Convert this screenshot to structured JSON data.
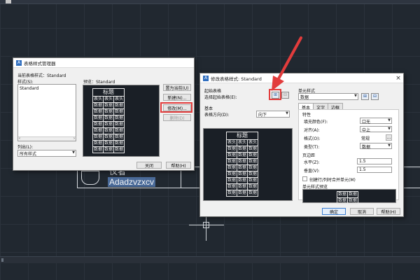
{
  "canvas": {
    "text_fragment": "仪者",
    "selected_text": "Adadzvzxcv"
  },
  "style_manager": {
    "title": "表格样式管理器",
    "current_style_label": "当前表格样式：Standard",
    "styles_label": "样式(S):",
    "style_items": [
      "Standard"
    ],
    "preview_label": "预览：Standard",
    "list_label": "列出(L):",
    "list_value": "所有样式",
    "buttons": {
      "set_current": "置为当前(U)",
      "new": "新建(N)...",
      "modify": "修改(M)...",
      "delete": "删除(D)",
      "close": "关闭",
      "help": "帮助(H)"
    },
    "preview_table": {
      "title": "标题",
      "header": [
        "表头",
        "表头",
        "表头"
      ],
      "rows": [
        [
          "数据",
          "数据",
          "数据"
        ],
        [
          "数据",
          "数据",
          "数据"
        ],
        [
          "数据",
          "数据",
          "数据"
        ],
        [
          "数据",
          "数据",
          "数据"
        ],
        [
          "数据",
          "数据",
          "数据"
        ],
        [
          "数据",
          "数据",
          "数据"
        ],
        [
          "数据",
          "数据",
          "数据"
        ],
        [
          "数据",
          "数据",
          "数据"
        ]
      ]
    }
  },
  "modify_dialog": {
    "title": "修改表格样式: Standard",
    "start_table_label": "起始表格",
    "choose_start_label": "选择起始表格(E):",
    "basic_label": "基本",
    "direction_label": "表格方向(D):",
    "direction_value": "向下",
    "cell_style_label": "单元样式",
    "cell_style_value": "数据",
    "tabs": [
      "基本",
      "文字",
      "边框"
    ],
    "properties_label": "特性",
    "fill_color_label": "填充颜色(F):",
    "fill_color_value": "口无",
    "align_label": "对齐(A):",
    "align_value": "中上",
    "format_label": "格式(O):",
    "format_value": "常规",
    "type_label": "类型(T):",
    "type_value": "数据",
    "margins_label": "页边距",
    "horizontal_label": "水平(Z):",
    "horizontal_value": "1.5",
    "vertical_label": "垂直(V):",
    "vertical_value": "1.5",
    "merge_label": "创建行/列时合并单元(M)",
    "cell_preview_label": "单元样式预览",
    "cell_preview": [
      "数据",
      "数据",
      "数据",
      "数据"
    ],
    "buttons": {
      "ok": "确定",
      "cancel": "取消",
      "help": "帮助(H)"
    },
    "preview_table": {
      "title": "标题",
      "header": [
        "表头",
        "表头",
        "表头"
      ],
      "rows": [
        [
          "数据",
          "数据",
          "数据"
        ],
        [
          "数据",
          "数据",
          "数据"
        ],
        [
          "数据",
          "数据",
          "数据"
        ],
        [
          "数据",
          "数据",
          "数据"
        ],
        [
          "数据",
          "数据",
          "数据"
        ],
        [
          "数据",
          "数据",
          "数据"
        ],
        [
          "数据",
          "数据",
          "数据"
        ],
        [
          "数据",
          "数据",
          "数据"
        ]
      ]
    }
  },
  "annotation": {
    "highlight_color": "#e23c3c",
    "arrow_color": "#e23c3c"
  }
}
